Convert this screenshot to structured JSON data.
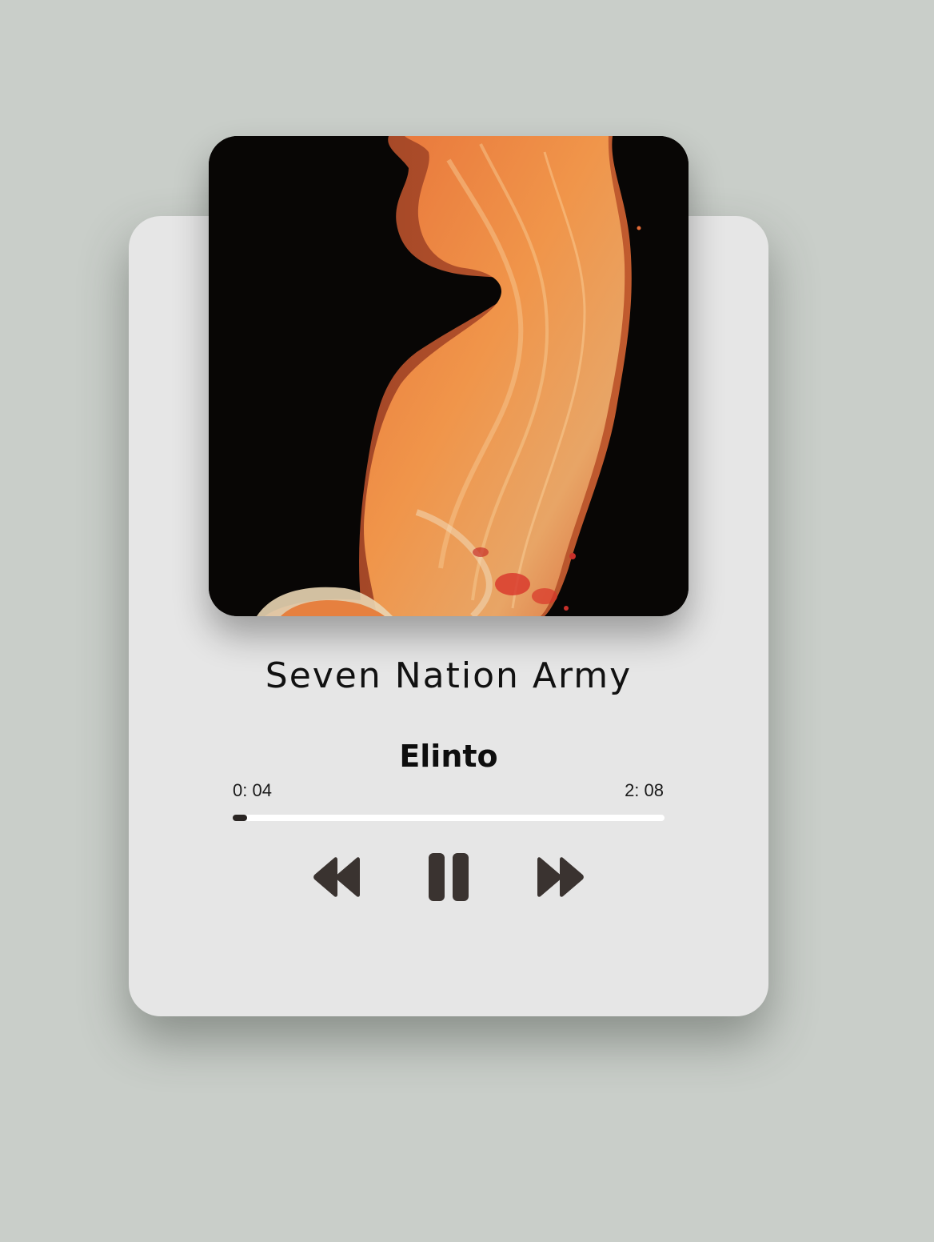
{
  "track": {
    "title": "Seven Nation Army",
    "artist": "Elinto"
  },
  "playback": {
    "current_time": "0: 04",
    "total_time": "2: 08",
    "progress": 0.03
  },
  "controls": {
    "prev_icon": "rewind-icon",
    "play_icon": "pause-icon",
    "next_icon": "fast-forward-icon"
  },
  "colors": {
    "background": "#c9cec9",
    "card": "#e6e6e6",
    "controls": "#3a3330",
    "progress_track": "#ffffff",
    "progress_fill": "#2a2523"
  }
}
